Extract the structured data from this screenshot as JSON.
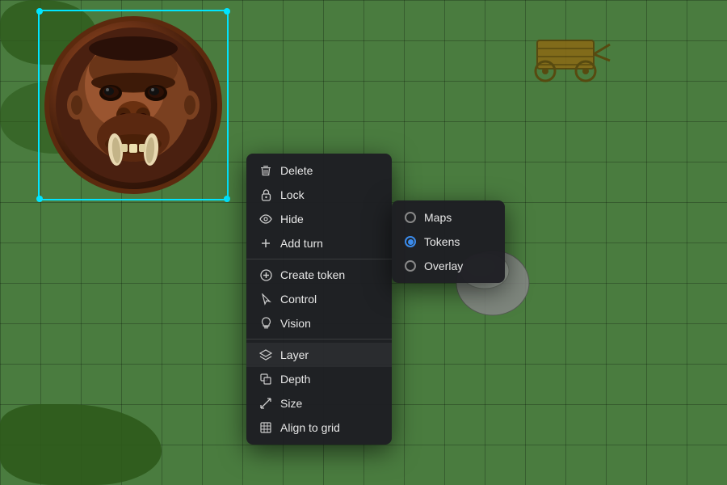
{
  "map": {
    "background_color": "#4a7c3f",
    "grid_color": "rgba(0,0,0,0.25)",
    "grid_size": 50
  },
  "token": {
    "name": "Orc",
    "selected": true
  },
  "context_menu": {
    "items": [
      {
        "id": "delete",
        "label": "Delete",
        "icon": "trash",
        "separator_after": false
      },
      {
        "id": "lock",
        "label": "Lock",
        "icon": "lock",
        "separator_after": false
      },
      {
        "id": "hide",
        "label": "Hide",
        "icon": "eye",
        "separator_after": false
      },
      {
        "id": "add-turn",
        "label": "Add turn",
        "icon": "plus",
        "separator_after": true
      },
      {
        "id": "create-token",
        "label": "Create token",
        "icon": "circle-plus",
        "separator_after": false
      },
      {
        "id": "control",
        "label": "Control",
        "icon": "cursor",
        "separator_after": false
      },
      {
        "id": "vision",
        "label": "Vision",
        "icon": "lightbulb",
        "separator_after": true
      },
      {
        "id": "layer",
        "label": "Layer",
        "icon": "layers",
        "separator_after": false
      },
      {
        "id": "depth",
        "label": "Depth",
        "icon": "depth",
        "separator_after": false
      },
      {
        "id": "size",
        "label": "Size",
        "icon": "resize",
        "separator_after": false
      },
      {
        "id": "align-to-grid",
        "label": "Align to grid",
        "icon": "grid",
        "separator_after": false
      }
    ]
  },
  "layer_submenu": {
    "items": [
      {
        "id": "maps",
        "label": "Maps",
        "selected": false
      },
      {
        "id": "tokens",
        "label": "Tokens",
        "selected": true
      },
      {
        "id": "overlay",
        "label": "Overlay",
        "selected": false
      }
    ]
  }
}
